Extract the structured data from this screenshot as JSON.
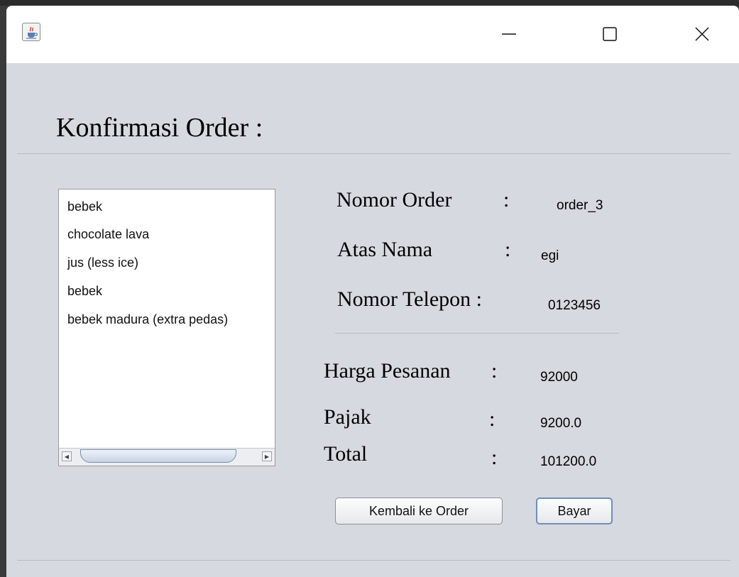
{
  "heading": "Konfirmasi Order :",
  "order_items": [
    "bebek",
    "chocolate lava",
    "jus (less ice)",
    "bebek",
    "bebek madura (extra pedas)"
  ],
  "info": {
    "order_number_label": "Nomor Order",
    "order_number_colon": ":",
    "order_number_value": "order_3",
    "name_label": "Atas Nama",
    "name_colon": ":",
    "name_value": "egi",
    "phone_label": "Nomor Telepon :",
    "phone_value": "0123456"
  },
  "price": {
    "subtotal_label": "Harga Pesanan",
    "subtotal_colon": ":",
    "subtotal_value": "92000",
    "tax_label": "Pajak",
    "tax_colon": ":",
    "tax_value": "9200.0",
    "total_label": "Total",
    "total_colon": ":",
    "total_value": "101200.0"
  },
  "buttons": {
    "back_label": "Kembali ke Order",
    "pay_label": "Bayar"
  },
  "icons": {
    "app": "java-cup-icon",
    "minimize": "minimize-icon",
    "maximize": "maximize-icon",
    "close": "close-icon",
    "scroll_left": "scroll-left-arrow-icon",
    "scroll_right": "scroll-right-arrow-icon"
  }
}
